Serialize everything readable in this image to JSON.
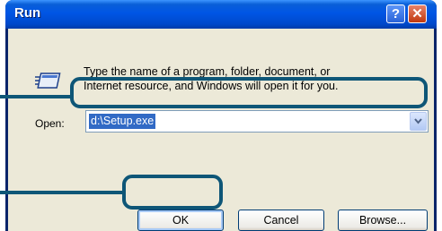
{
  "window": {
    "title": "Run",
    "help_glyph": "?",
    "close_glyph": "✕"
  },
  "dialog": {
    "icon": "run-icon",
    "description_line1": "Type the name of a program, folder, document, or",
    "description_line2": "Internet resource, and Windows will open it for you.",
    "open_label": "Open:",
    "open_value": "d:\\Setup.exe"
  },
  "buttons": {
    "ok": "OK",
    "cancel": "Cancel",
    "browse": "Browse..."
  },
  "colors": {
    "titlebar": "#0055e5",
    "selection": "#316ac5",
    "callout": "#0e5677",
    "dialog_bg": "#ece9d8"
  }
}
